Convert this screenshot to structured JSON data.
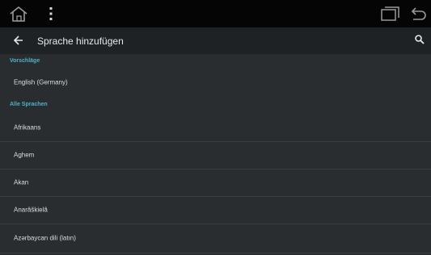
{
  "toolbar": {
    "title": "Sprache hinzufügen"
  },
  "icons": {
    "home": "home-icon",
    "more": "more-vertical-icon",
    "recents": "recent-apps-icon",
    "system_back": "system-back-icon",
    "back": "back-arrow-icon",
    "search": "search-icon"
  },
  "sections": {
    "suggestions_header": "Vorschläge",
    "all_header": "Alle Sprachen"
  },
  "suggested": [
    "English (Germany)"
  ],
  "languages": [
    "Afrikaans",
    "Aghem",
    "Akan",
    "Anarâškielâ",
    "Azərbaycan dili (latın)"
  ],
  "colors": {
    "status_bar": "#050505",
    "toolbar": "#1f2224",
    "background": "#2a2d30",
    "accent": "#4fb0c8"
  }
}
